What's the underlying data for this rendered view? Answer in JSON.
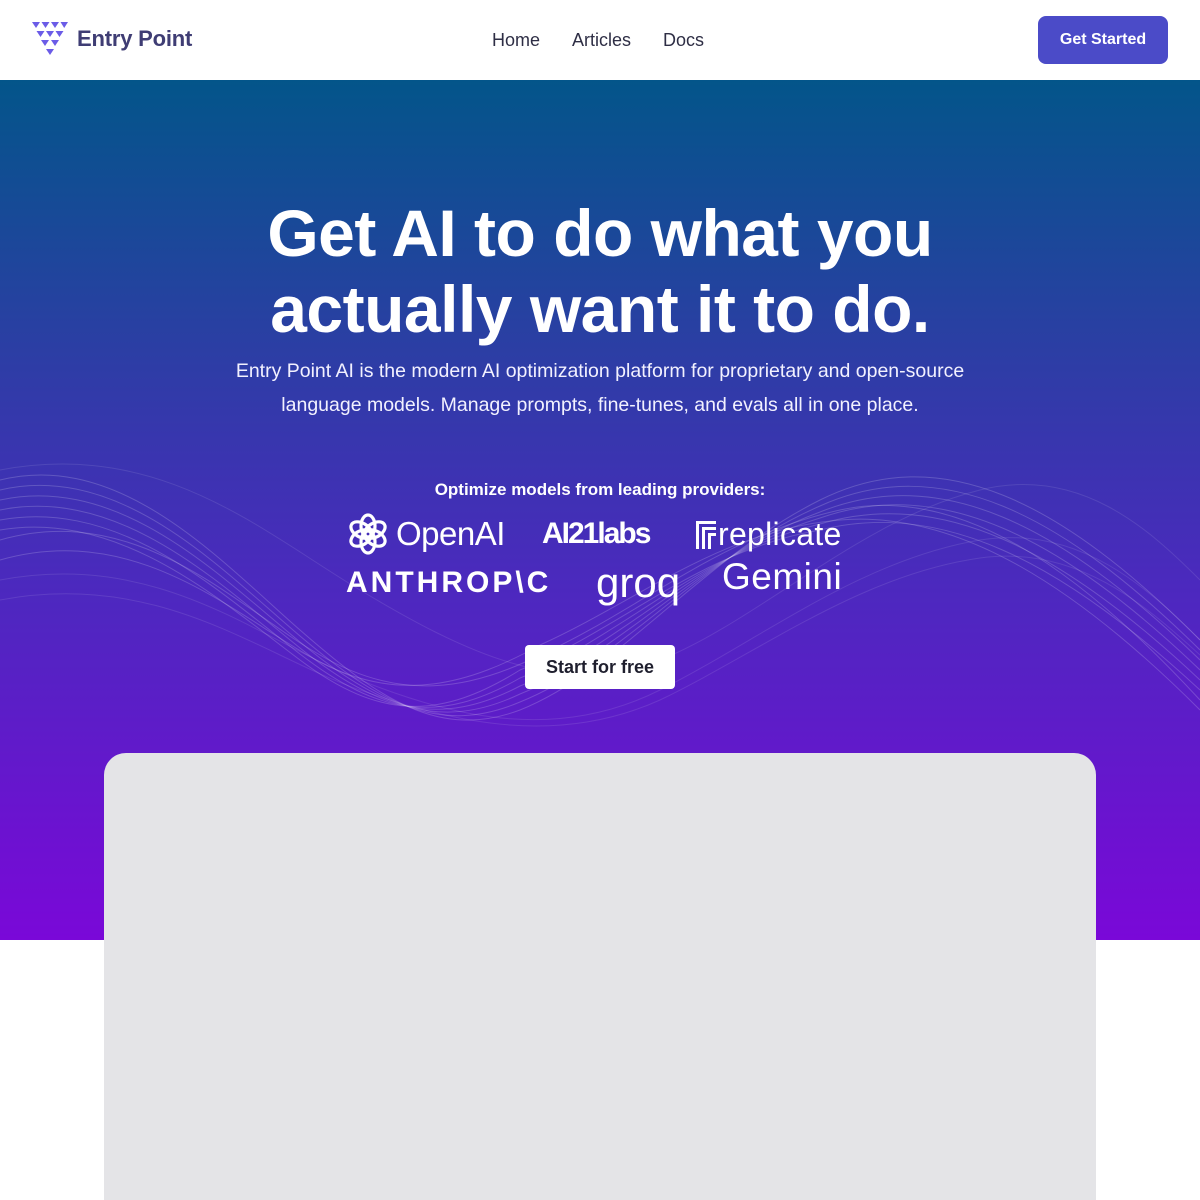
{
  "header": {
    "brand_name": "Entry Point",
    "nav": [
      "Home",
      "Articles",
      "Docs"
    ],
    "cta_label": "Get Started"
  },
  "hero": {
    "title_line1": "Get AI to do what you",
    "title_line2": "actually want it to do.",
    "subtitle_line1": "Entry Point AI is the modern AI optimization platform for proprietary and open-source",
    "subtitle_line2": "language models. Manage prompts, fine-tunes, and evals all in one place.",
    "providers_label": "Optimize models from leading providers:",
    "providers": [
      {
        "name": "OpenAI",
        "icon": "openai-icon"
      },
      {
        "name": "AI21labs",
        "icon": "ai21labs-logo"
      },
      {
        "name": "replicate",
        "icon": "replicate-icon"
      },
      {
        "name": "ANTHROP\\C",
        "icon": "anthropic-logo"
      },
      {
        "name": "groq",
        "icon": "groq-logo"
      },
      {
        "name": "Gemini",
        "icon": "gemini-logo"
      }
    ],
    "cta_label": "Start for free"
  },
  "colors": {
    "accent": "#4b4bc8",
    "brand_text": "#3f3d74",
    "gradient_top": "#03558a",
    "gradient_bottom": "#7a08d8",
    "preview_bg": "#e4e4e7"
  }
}
